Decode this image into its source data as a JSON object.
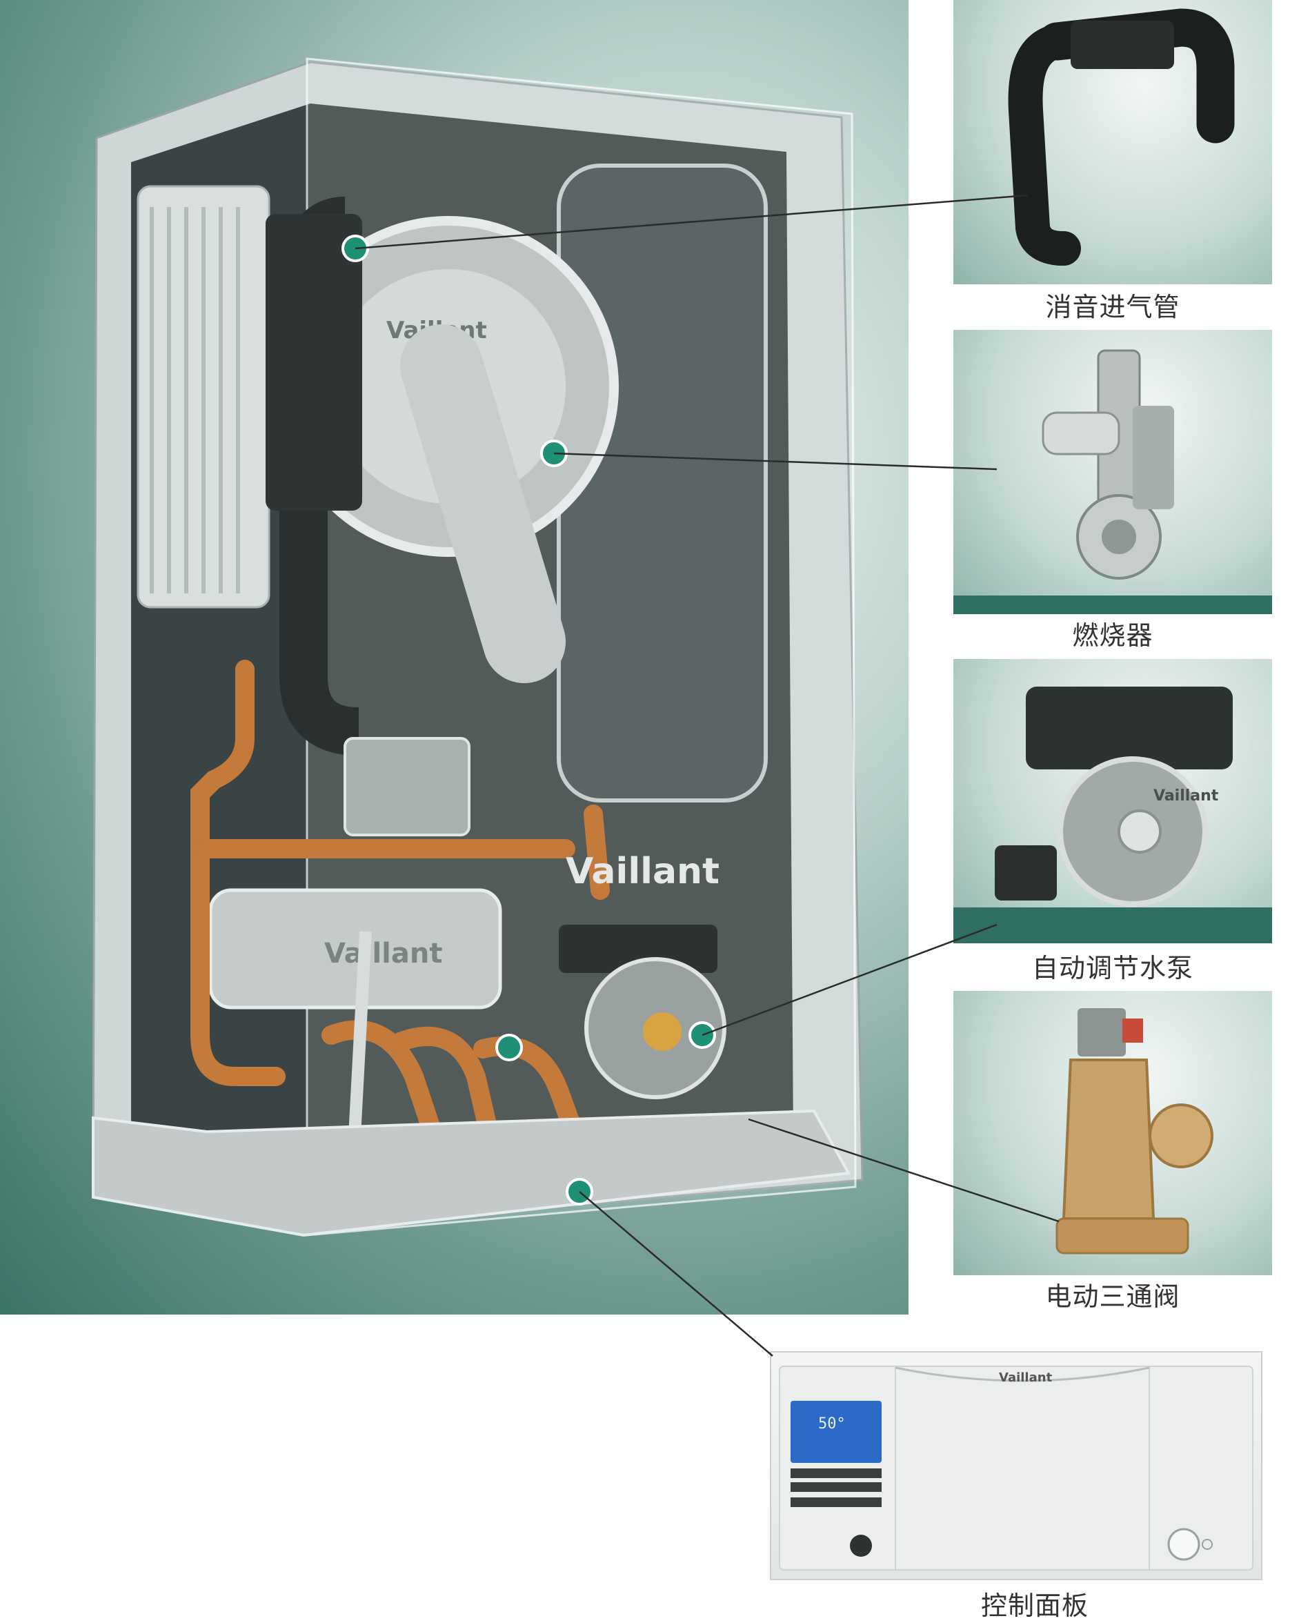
{
  "components": [
    {
      "label": "消音进气管",
      "icon": "intake-pipe-icon"
    },
    {
      "label": "燃烧器",
      "icon": "burner-icon"
    },
    {
      "label": "自动调节水泵",
      "icon": "water-pump-icon"
    },
    {
      "label": "电动三通阀",
      "icon": "three-way-valve-icon"
    },
    {
      "label": "控制面板",
      "icon": "control-panel-icon"
    }
  ],
  "brand": "Vaillant",
  "display_value": "50°",
  "colors": {
    "marker": "#1f8f75",
    "copper": "#c47a3a",
    "background_teal": "#5f8f86"
  }
}
